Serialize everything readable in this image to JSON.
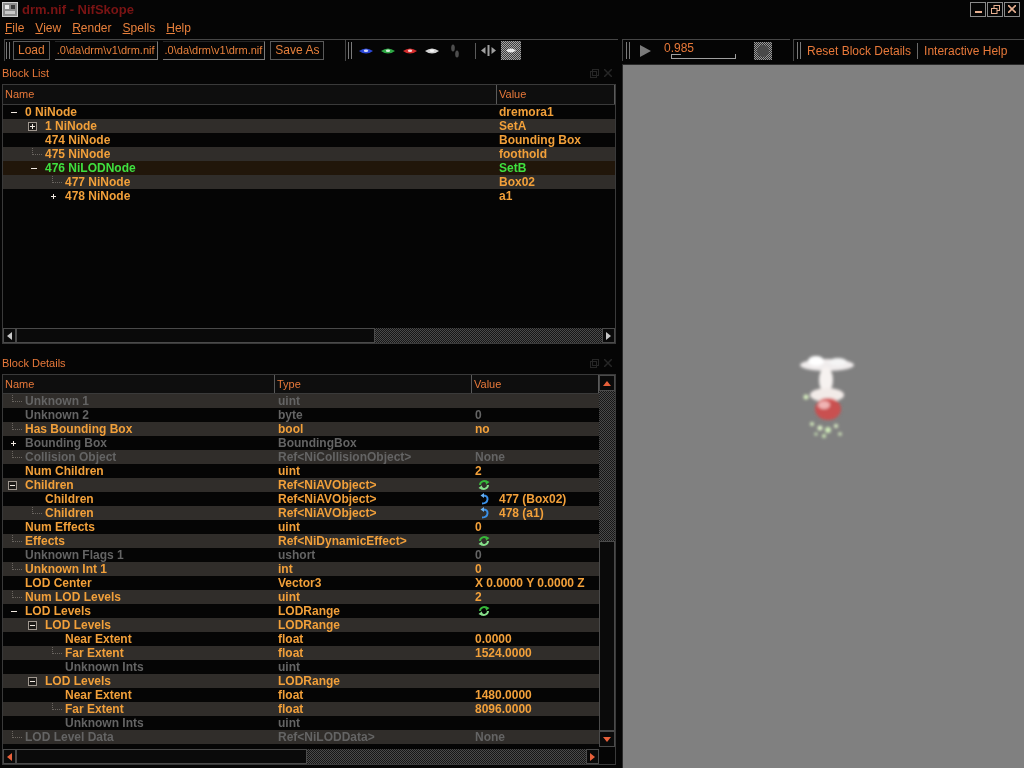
{
  "window": {
    "title": "drm.nif - NifSkope"
  },
  "menu": [
    "File",
    "View",
    "Render",
    "Spells",
    "Help"
  ],
  "file_toolbar": {
    "load_button": "Load",
    "paths": [
      ".0\\da\\drm\\v1\\drm.nif",
      ".0\\da\\drm\\v1\\drm.nif"
    ],
    "save_button": "Save As"
  },
  "animation_toolbar": {
    "time": "0.985",
    "level": 0
  },
  "help_toolbar": {
    "buttons": [
      "Reset Block Details",
      "Interactive Help"
    ]
  },
  "block_list": {
    "title": "Block List",
    "columns": [
      "Name",
      "Value"
    ],
    "rows": [
      {
        "name": "0 NiNode",
        "value": "dremora1",
        "selected": false,
        "expanded": true,
        "children": [
          {
            "name": "1 NiNode",
            "value": "SetA",
            "selected": false,
            "expanded": false
          },
          {
            "name": "474 NiNode",
            "value": "Bounding Box",
            "selected": false
          },
          {
            "name": "475 NiNode",
            "value": "foothold",
            "selected": false
          },
          {
            "name": "476 NiLODNode",
            "value": "SetB",
            "selected": true,
            "expanded": true,
            "children": [
              {
                "name": "477 NiNode",
                "value": "Box02",
                "selected": false
              },
              {
                "name": "478 NiNode",
                "value": "a1",
                "selected": false,
                "expanded": false
              }
            ]
          }
        ]
      }
    ]
  },
  "block_details": {
    "title": "Block Details",
    "columns": [
      "Name",
      "Type",
      "Value"
    ],
    "rows": [
      {
        "name": "Unknown 1",
        "type": "uint",
        "kind": "field",
        "disabled": true
      },
      {
        "name": "Unknown 2",
        "type": "byte",
        "value": "0",
        "kind": "field",
        "disabled": true
      },
      {
        "name": "Has Bounding Box",
        "type": "bool",
        "value": "no",
        "kind": "field",
        "disabled": false
      },
      {
        "name": "Bounding Box",
        "type": "BoundingBox",
        "kind": "field",
        "disabled": true,
        "expanded": false
      },
      {
        "name": "Collision Object",
        "type": "Ref<NiCollisionObject>",
        "value": "None",
        "kind": "field",
        "disabled": true
      },
      {
        "name": "Num Children",
        "type": "uint",
        "value": "2",
        "kind": "field",
        "disabled": false
      },
      {
        "name": "Children",
        "type": "Ref<NiAVObject>",
        "kind": "array",
        "disabled": false,
        "expanded": true,
        "children": [
          {
            "name": "Children",
            "type": "Ref<NiAVObject>",
            "value": "477 (Box02)",
            "kind": "link",
            "disabled": false
          },
          {
            "name": "Children",
            "type": "Ref<NiAVObject>",
            "value": "478 (a1)",
            "kind": "link",
            "disabled": false
          }
        ]
      },
      {
        "name": "Num Effects",
        "type": "uint",
        "value": "0",
        "kind": "field",
        "disabled": false
      },
      {
        "name": "Effects",
        "type": "Ref<NiDynamicEffect>",
        "kind": "array",
        "disabled": false
      },
      {
        "name": "Unknown Flags 1",
        "type": "ushort",
        "value": "0",
        "kind": "field",
        "disabled": true
      },
      {
        "name": "Unknown Int 1",
        "type": "int",
        "value": "0",
        "kind": "field",
        "disabled": false
      },
      {
        "name": "LOD Center",
        "type": "Vector3",
        "value": "X 0.0000 Y 0.0000 Z",
        "kind": "field",
        "disabled": false
      },
      {
        "name": "Num LOD Levels",
        "type": "uint",
        "value": "2",
        "kind": "field",
        "disabled": false
      },
      {
        "name": "LOD Levels",
        "type": "LODRange",
        "kind": "array",
        "disabled": false,
        "expanded": true,
        "children": [
          {
            "name": "LOD Levels",
            "type": "LODRange",
            "kind": "field",
            "disabled": false,
            "expanded": true,
            "children": [
              {
                "name": "Near Extent",
                "type": "float",
                "value": "0.0000",
                "kind": "field",
                "disabled": false
              },
              {
                "name": "Far Extent",
                "type": "float",
                "value": "1524.0000",
                "kind": "field",
                "disabled": false
              },
              {
                "name": "Unknown Ints",
                "type": "uint",
                "kind": "field",
                "disabled": true
              }
            ]
          },
          {
            "name": "LOD Levels",
            "type": "LODRange",
            "kind": "field",
            "disabled": false,
            "expanded": true,
            "children": [
              {
                "name": "Near Extent",
                "type": "float",
                "value": "1480.0000",
                "kind": "field",
                "disabled": false
              },
              {
                "name": "Far Extent",
                "type": "float",
                "value": "8096.0000",
                "kind": "field",
                "disabled": false
              },
              {
                "name": "Unknown Ints",
                "type": "uint",
                "kind": "field",
                "disabled": true
              }
            ]
          }
        ]
      },
      {
        "name": "LOD Level Data",
        "type": "Ref<NiLODData>",
        "value": "None",
        "kind": "field",
        "disabled": true
      }
    ]
  }
}
